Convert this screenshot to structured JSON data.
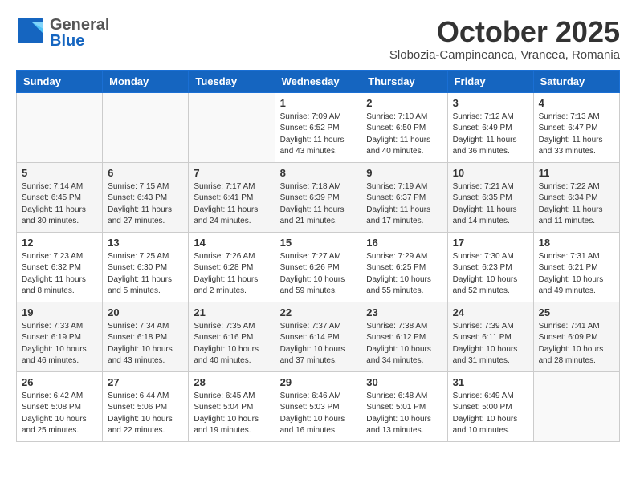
{
  "header": {
    "logo_general": "General",
    "logo_blue": "Blue",
    "month_title": "October 2025",
    "subtitle": "Slobozia-Campineanca, Vrancea, Romania"
  },
  "weekdays": [
    "Sunday",
    "Monday",
    "Tuesday",
    "Wednesday",
    "Thursday",
    "Friday",
    "Saturday"
  ],
  "weeks": [
    [
      {
        "day": "",
        "info": ""
      },
      {
        "day": "",
        "info": ""
      },
      {
        "day": "",
        "info": ""
      },
      {
        "day": "1",
        "info": "Sunrise: 7:09 AM\nSunset: 6:52 PM\nDaylight: 11 hours and 43 minutes."
      },
      {
        "day": "2",
        "info": "Sunrise: 7:10 AM\nSunset: 6:50 PM\nDaylight: 11 hours and 40 minutes."
      },
      {
        "day": "3",
        "info": "Sunrise: 7:12 AM\nSunset: 6:49 PM\nDaylight: 11 hours and 36 minutes."
      },
      {
        "day": "4",
        "info": "Sunrise: 7:13 AM\nSunset: 6:47 PM\nDaylight: 11 hours and 33 minutes."
      }
    ],
    [
      {
        "day": "5",
        "info": "Sunrise: 7:14 AM\nSunset: 6:45 PM\nDaylight: 11 hours and 30 minutes."
      },
      {
        "day": "6",
        "info": "Sunrise: 7:15 AM\nSunset: 6:43 PM\nDaylight: 11 hours and 27 minutes."
      },
      {
        "day": "7",
        "info": "Sunrise: 7:17 AM\nSunset: 6:41 PM\nDaylight: 11 hours and 24 minutes."
      },
      {
        "day": "8",
        "info": "Sunrise: 7:18 AM\nSunset: 6:39 PM\nDaylight: 11 hours and 21 minutes."
      },
      {
        "day": "9",
        "info": "Sunrise: 7:19 AM\nSunset: 6:37 PM\nDaylight: 11 hours and 17 minutes."
      },
      {
        "day": "10",
        "info": "Sunrise: 7:21 AM\nSunset: 6:35 PM\nDaylight: 11 hours and 14 minutes."
      },
      {
        "day": "11",
        "info": "Sunrise: 7:22 AM\nSunset: 6:34 PM\nDaylight: 11 hours and 11 minutes."
      }
    ],
    [
      {
        "day": "12",
        "info": "Sunrise: 7:23 AM\nSunset: 6:32 PM\nDaylight: 11 hours and 8 minutes."
      },
      {
        "day": "13",
        "info": "Sunrise: 7:25 AM\nSunset: 6:30 PM\nDaylight: 11 hours and 5 minutes."
      },
      {
        "day": "14",
        "info": "Sunrise: 7:26 AM\nSunset: 6:28 PM\nDaylight: 11 hours and 2 minutes."
      },
      {
        "day": "15",
        "info": "Sunrise: 7:27 AM\nSunset: 6:26 PM\nDaylight: 10 hours and 59 minutes."
      },
      {
        "day": "16",
        "info": "Sunrise: 7:29 AM\nSunset: 6:25 PM\nDaylight: 10 hours and 55 minutes."
      },
      {
        "day": "17",
        "info": "Sunrise: 7:30 AM\nSunset: 6:23 PM\nDaylight: 10 hours and 52 minutes."
      },
      {
        "day": "18",
        "info": "Sunrise: 7:31 AM\nSunset: 6:21 PM\nDaylight: 10 hours and 49 minutes."
      }
    ],
    [
      {
        "day": "19",
        "info": "Sunrise: 7:33 AM\nSunset: 6:19 PM\nDaylight: 10 hours and 46 minutes."
      },
      {
        "day": "20",
        "info": "Sunrise: 7:34 AM\nSunset: 6:18 PM\nDaylight: 10 hours and 43 minutes."
      },
      {
        "day": "21",
        "info": "Sunrise: 7:35 AM\nSunset: 6:16 PM\nDaylight: 10 hours and 40 minutes."
      },
      {
        "day": "22",
        "info": "Sunrise: 7:37 AM\nSunset: 6:14 PM\nDaylight: 10 hours and 37 minutes."
      },
      {
        "day": "23",
        "info": "Sunrise: 7:38 AM\nSunset: 6:12 PM\nDaylight: 10 hours and 34 minutes."
      },
      {
        "day": "24",
        "info": "Sunrise: 7:39 AM\nSunset: 6:11 PM\nDaylight: 10 hours and 31 minutes."
      },
      {
        "day": "25",
        "info": "Sunrise: 7:41 AM\nSunset: 6:09 PM\nDaylight: 10 hours and 28 minutes."
      }
    ],
    [
      {
        "day": "26",
        "info": "Sunrise: 6:42 AM\nSunset: 5:08 PM\nDaylight: 10 hours and 25 minutes."
      },
      {
        "day": "27",
        "info": "Sunrise: 6:44 AM\nSunset: 5:06 PM\nDaylight: 10 hours and 22 minutes."
      },
      {
        "day": "28",
        "info": "Sunrise: 6:45 AM\nSunset: 5:04 PM\nDaylight: 10 hours and 19 minutes."
      },
      {
        "day": "29",
        "info": "Sunrise: 6:46 AM\nSunset: 5:03 PM\nDaylight: 10 hours and 16 minutes."
      },
      {
        "day": "30",
        "info": "Sunrise: 6:48 AM\nSunset: 5:01 PM\nDaylight: 10 hours and 13 minutes."
      },
      {
        "day": "31",
        "info": "Sunrise: 6:49 AM\nSunset: 5:00 PM\nDaylight: 10 hours and 10 minutes."
      },
      {
        "day": "",
        "info": ""
      }
    ]
  ]
}
